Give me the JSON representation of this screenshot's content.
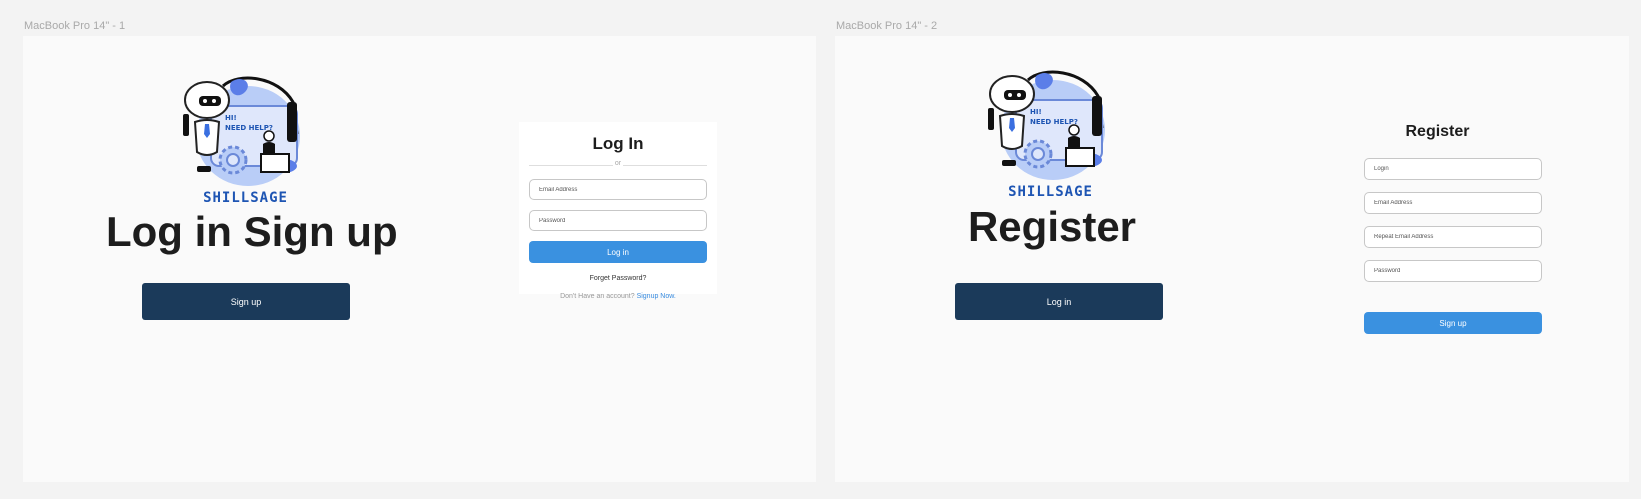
{
  "frames": [
    {
      "label": "MacBook Pro 14\" - 1"
    },
    {
      "label": "MacBook Pro 14\" - 2"
    }
  ],
  "logo": {
    "brand_text": "SHILLSAGE",
    "bubble_line1": "HI!",
    "bubble_line2": "NEED HELP?"
  },
  "login_page": {
    "heading": "Log in Sign up",
    "signup_button": "Sign up",
    "card": {
      "title": "Log In",
      "divider_text": "or",
      "email_placeholder": "Email Address",
      "password_placeholder": "Password",
      "login_button": "Log in",
      "forgot_password": "Forget Password?"
    },
    "no_account_text": "Don't Have an account?",
    "signup_link": "Signup Now."
  },
  "register_page": {
    "heading": "Register",
    "login_button": "Log in",
    "form": {
      "title": "Register",
      "login_placeholder": "Login",
      "email_placeholder": "Email Address",
      "repeat_email_placeholder": "Repeat Email Address",
      "password_placeholder": "Password",
      "signup_button": "Sign up"
    }
  },
  "colors": {
    "canvas": "#f3f3f3",
    "frame": "#fafafa",
    "dark_button": "#1b3a5a",
    "accent_blue": "#3a91e0",
    "brand_blue": "#1e55b3"
  }
}
